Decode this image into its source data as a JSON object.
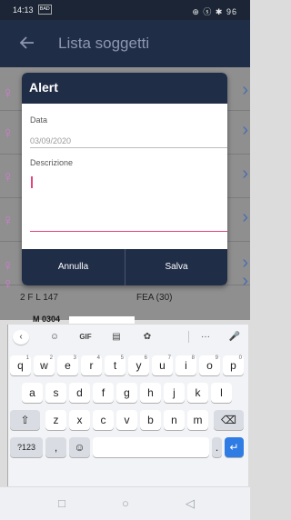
{
  "status_bar": {
    "time": "14:13",
    "left_icon": "ᴮᴬᴰ",
    "right_icons": "⊕ ⓢ ✱ 96"
  },
  "app_bar": {
    "title": "Lista soggetti"
  },
  "list": {
    "rows": [
      {
        "text": "2  F  L  147",
        "sub": "FEA (30)"
      }
    ],
    "partial": "M 0304"
  },
  "dialog": {
    "title": "Alert",
    "date_label": "Data",
    "date_value": "03/09/2020",
    "description_label": "Descrizione",
    "cancel_label": "Annulla",
    "save_label": "Salva"
  },
  "keyboard": {
    "toolbar": {
      "gif": "GIF",
      "more": "···"
    },
    "row1": [
      "q",
      "w",
      "e",
      "r",
      "t",
      "y",
      "u",
      "i",
      "o",
      "p"
    ],
    "row1_hints": [
      "1",
      "2",
      "3",
      "4",
      "5",
      "6",
      "7",
      "8",
      "9",
      "0"
    ],
    "row2": [
      "a",
      "s",
      "d",
      "f",
      "g",
      "h",
      "j",
      "k",
      "l"
    ],
    "row3": [
      "z",
      "x",
      "c",
      "v",
      "b",
      "n",
      "m"
    ],
    "symbols": "?123",
    "comma": ",",
    "period": "."
  }
}
